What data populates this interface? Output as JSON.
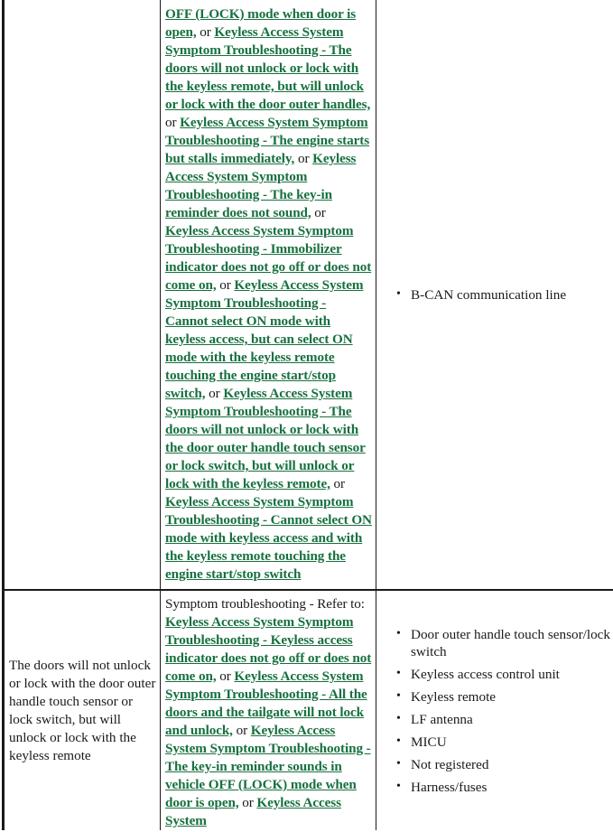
{
  "document": {
    "type": "service-manual-symptom-troubleshooting-table",
    "colors": {
      "link_green": "#17703f",
      "text_black": "#1a1a1a",
      "border": "#1a1a1a",
      "background": "#ffffff"
    }
  },
  "rows": [
    {
      "cause": "",
      "symptom_segments": [
        {
          "style": "link",
          "text": "OFF (LOCK) mode when door is open,"
        },
        {
          "style": "plain",
          "text": " or "
        },
        {
          "style": "link",
          "text": "Keyless Access System Symptom Troubleshooting - The doors will not unlock or lock with the keyless remote, but will unlock or lock with the door outer handles,"
        },
        {
          "style": "plain",
          "text": " or "
        },
        {
          "style": "link",
          "text": "Keyless Access System Symptom Troubleshooting - The engine starts but stalls immediately,"
        },
        {
          "style": "plain",
          "text": " or "
        },
        {
          "style": "link",
          "text": "Keyless Access System Symptom Troubleshooting - The key-in reminder does not sound,"
        },
        {
          "style": "plain",
          "text": " or "
        },
        {
          "style": "link",
          "text": "Keyless Access System Symptom Troubleshooting - Immobilizer indicator does not go off or does not come on,"
        },
        {
          "style": "plain",
          "text": " or "
        },
        {
          "style": "link",
          "text": "Keyless Access System Symptom Troubleshooting - Cannot select ON mode with keyless access, but can select ON mode with the keyless remote touching the engine start/stop switch,"
        },
        {
          "style": "plain",
          "text": " or "
        },
        {
          "style": "link",
          "text": "Keyless Access System Symptom Troubleshooting - The doors will not unlock or lock with the door outer handle touch sensor or lock switch, but will unlock or lock with the keyless remote,"
        },
        {
          "style": "plain",
          "text": " or "
        },
        {
          "style": "link",
          "text": "Keyless Access System Symptom Troubleshooting - Cannot select ON mode with keyless access and with the keyless remote touching the engine start/stop switch"
        }
      ],
      "parts": [
        "B-CAN communication line"
      ]
    },
    {
      "cause": "The doors will not unlock or lock with the door outer handle touch sensor or lock switch, but will unlock or lock with the keyless remote",
      "symptom_segments": [
        {
          "style": "plain",
          "text": "Symptom troubleshooting - Refer to: "
        },
        {
          "style": "link",
          "text": "Keyless Access System Symptom Troubleshooting - Keyless access indicator does not go off or does not come on,"
        },
        {
          "style": "plain",
          "text": " or "
        },
        {
          "style": "link",
          "text": "Keyless Access System Symptom Troubleshooting - All the doors and the tailgate will not lock and unlock,"
        },
        {
          "style": "plain",
          "text": " or "
        },
        {
          "style": "link",
          "text": "Keyless Access System Symptom Troubleshooting - The key-in reminder sounds in vehicle OFF (LOCK) mode when door is open,"
        },
        {
          "style": "plain",
          "text": " or "
        },
        {
          "style": "link",
          "text": "Keyless Access System"
        }
      ],
      "parts": [
        "Door outer handle touch sensor/lock switch",
        "Keyless access control unit",
        "Keyless remote",
        "LF antenna",
        "MICU",
        "Not registered",
        "Harness/fuses"
      ]
    }
  ]
}
